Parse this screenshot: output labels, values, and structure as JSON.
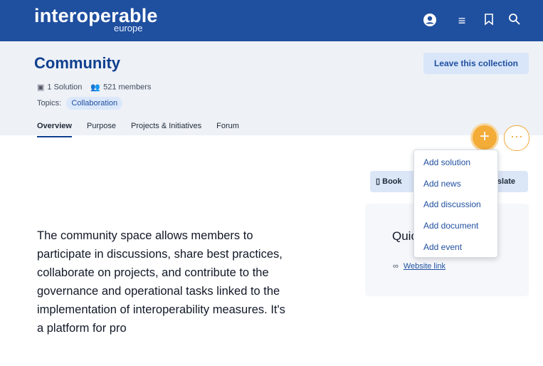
{
  "site": {
    "logo_main": "interoperable",
    "logo_sub": "europe",
    "icons": [
      "account-icon",
      "menu-icon",
      "bookmark-icon",
      "search-icon"
    ]
  },
  "collection": {
    "title": "Community",
    "leave_button": "Leave this collection",
    "solutions": "1 Solution",
    "members": "521 members",
    "topics_label": "Topics:",
    "topic": "Collaboration"
  },
  "tabs": [
    {
      "label": "Overview",
      "active": true
    },
    {
      "label": "Purpose",
      "active": false
    },
    {
      "label": "Projects & Initiatives",
      "active": false
    },
    {
      "label": "Forum",
      "active": false
    }
  ],
  "actions": {
    "plus": "+",
    "more": "···",
    "book_label": "Book",
    "translate_label": "slate"
  },
  "dropdown": {
    "items": [
      "Add solution",
      "Add news",
      "Add discussion",
      "Add document",
      "Add event"
    ]
  },
  "quick": {
    "title": "Quic",
    "website_link": "Website link"
  },
  "description": "The community space allows members to participate in discussions, share best practices, collaborate on projects, and contribute to the governance and operational tasks linked to the implementation of interoperability measures. It's a platform for pro",
  "colors": {
    "brand_blue": "#1f4f9f",
    "accent_orange": "#f3ac38",
    "header_bg": "#eef1f6"
  }
}
